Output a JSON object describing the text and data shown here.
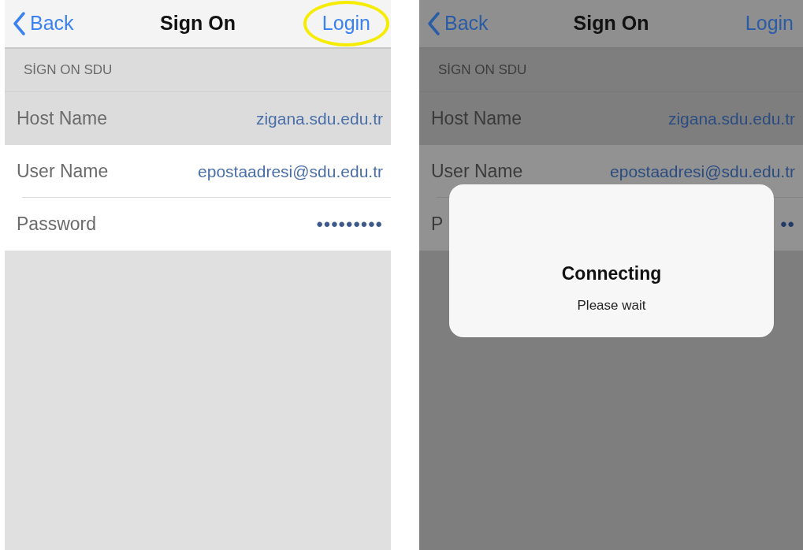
{
  "screens": [
    {
      "dimmed": false,
      "nav": {
        "back": "Back",
        "title": "Sign On",
        "action": {
          "label": "Login",
          "highlighted": true
        }
      },
      "section": "SİGN ON SDU",
      "rows": [
        {
          "label": "Host Name",
          "value": "zigana.sdu.edu.tr",
          "kind": "text",
          "selected": true
        },
        {
          "label": "User Name",
          "value": "epostaadresi@sdu.edu.tr",
          "kind": "text",
          "selected": false
        },
        {
          "label": "Password",
          "value": "•••••••••",
          "kind": "secure",
          "selected": false
        }
      ]
    },
    {
      "dimmed": true,
      "nav": {
        "back": "Back",
        "title": "Sign On",
        "action": {
          "label": "Login",
          "highlighted": false
        }
      },
      "section": "SİGN ON SDU",
      "rows": [
        {
          "label": "Host Name",
          "value": "zigana.sdu.edu.tr",
          "kind": "text",
          "selected": true
        },
        {
          "label": "User Name",
          "value": "epostaadresi@sdu.edu.tr",
          "kind": "text",
          "selected": false
        },
        {
          "label": "P",
          "value": "••",
          "kind": "secure",
          "selected": false
        }
      ],
      "alert": {
        "title": "Connecting",
        "message": "Please wait"
      }
    }
  ]
}
